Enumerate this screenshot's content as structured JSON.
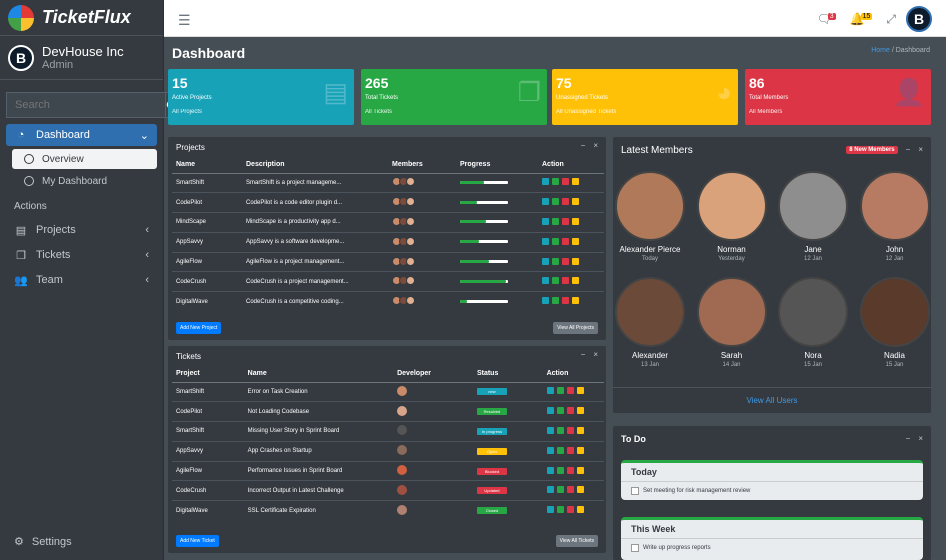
{
  "brand": {
    "name": "TicketFlux"
  },
  "user": {
    "name": "DevHouse Inc",
    "role": "Admin",
    "avatar_letter": "B"
  },
  "search": {
    "placeholder": "Search"
  },
  "nav": {
    "dashboard": "Dashboard",
    "overview": "Overview",
    "my_dashboard": "My Dashboard",
    "actions_header": "Actions",
    "projects": "Projects",
    "tickets": "Tickets",
    "team": "Team",
    "settings": "Settings"
  },
  "topbar": {
    "msg_count": "3",
    "notif_count": "15"
  },
  "page": {
    "title": "Dashboard",
    "breadcrumb_home": "Home",
    "breadcrumb_current": "Dashboard"
  },
  "stats": [
    {
      "value": "15",
      "label": "Active Projects",
      "link": "All Projects",
      "color": "#17a2b8"
    },
    {
      "value": "265",
      "label": "Total Tickets",
      "link": "All Tickets",
      "color": "#28a745"
    },
    {
      "value": "75",
      "label": "Unassigned Tickets",
      "link": "All Unassigned Tickets",
      "color": "#ffc107"
    },
    {
      "value": "86",
      "label": "Total Members",
      "link": "All Members",
      "color": "#dc3545"
    }
  ],
  "projects": {
    "title": "Projects",
    "columns": [
      "Name",
      "Description",
      "Members",
      "Progress",
      "Action"
    ],
    "rows": [
      {
        "name": "SmartShift",
        "desc": "SmartShift is a project manageme...",
        "progress": 0.5
      },
      {
        "name": "CodePilot",
        "desc": "CodePilot is a code editor plugin d...",
        "progress": 0.35
      },
      {
        "name": "MindScape",
        "desc": "MindScape is a productivity app d...",
        "progress": 0.55
      },
      {
        "name": "AppSavvy",
        "desc": "AppSavvy is a software developme...",
        "progress": 0.4
      },
      {
        "name": "AgileFlow",
        "desc": "AgileFlow is a project management...",
        "progress": 0.6
      },
      {
        "name": "CodeCrush",
        "desc": "CodeCrush is a project management...",
        "progress": 0.95
      },
      {
        "name": "DigitalWave",
        "desc": "CodeCrush is a competitive coding...",
        "progress": 0.15
      }
    ],
    "add_button": "Add New Project",
    "view_button": "View All Projects"
  },
  "tickets": {
    "title": "Tickets",
    "columns": [
      "Project",
      "Name",
      "Developer",
      "Status",
      "Action"
    ],
    "rows": [
      {
        "project": "SmartShift",
        "name": "Error on Task Creation",
        "status": "new",
        "status_color": "#17a2b8"
      },
      {
        "project": "CodePilot",
        "name": "Not Loading Codebase",
        "status": "Resolved",
        "status_color": "#28a745"
      },
      {
        "project": "SmartShift",
        "name": "Missing User Story in Sprint Board",
        "status": "In progress",
        "status_color": "#17a2b8"
      },
      {
        "project": "AppSavvy",
        "name": "App Crashes on Startup",
        "status": "Open",
        "status_color": "#ffc107"
      },
      {
        "project": "AgileFlow",
        "name": "Performance Issues in Sprint Board",
        "status": "Blocked",
        "status_color": "#dc3545"
      },
      {
        "project": "CodeCrush",
        "name": "Incorrect Output in Latest Challenge",
        "status": "Updated",
        "status_color": "#dc3545"
      },
      {
        "project": "DigitalWave",
        "name": "SSL Certificate Expiration",
        "status": "Closed",
        "status_color": "#28a745"
      }
    ],
    "add_button": "Add New Ticket",
    "view_button": "View All Tickets"
  },
  "members": {
    "title": "Latest Members",
    "badge": "8 New Members",
    "list": [
      {
        "name": "Alexander Pierce",
        "date": "Today",
        "color": "#b07a5a"
      },
      {
        "name": "Norman",
        "date": "Yesterday",
        "color": "#d9a27a"
      },
      {
        "name": "Jane",
        "date": "12 Jan",
        "color": "#8e8e8e"
      },
      {
        "name": "John",
        "date": "12 Jan",
        "color": "#b77b64"
      },
      {
        "name": "Alexander",
        "date": "13 Jan",
        "color": "#6b4a3a"
      },
      {
        "name": "Sarah",
        "date": "14 Jan",
        "color": "#a06a52"
      },
      {
        "name": "Nora",
        "date": "15 Jan",
        "color": "#555555"
      },
      {
        "name": "Nadia",
        "date": "15 Jan",
        "color": "#5a3a2a"
      }
    ],
    "view_all": "View All Users"
  },
  "todo": {
    "title": "To Do",
    "sections": [
      {
        "title": "Today",
        "items": [
          "Set meeting for risk management review"
        ]
      },
      {
        "title": "This Week",
        "items": [
          "Write up progress reports"
        ]
      }
    ]
  }
}
